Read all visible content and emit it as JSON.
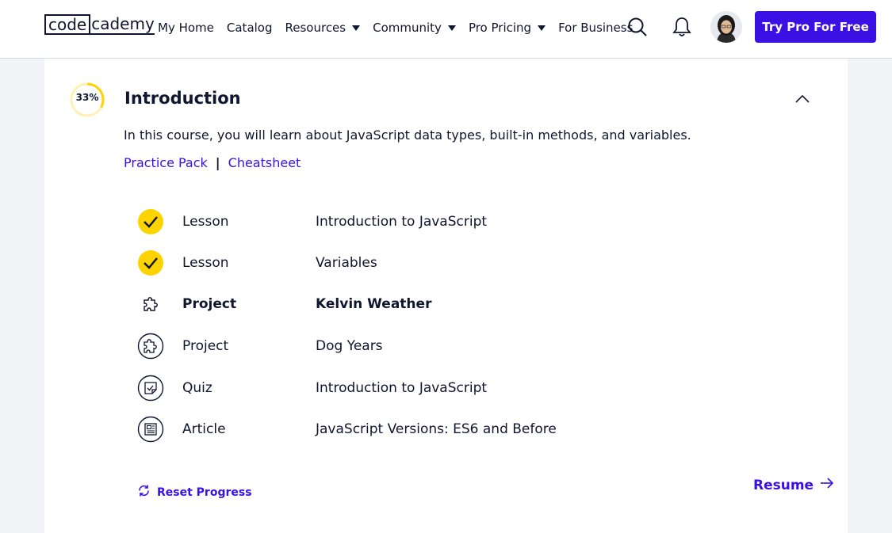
{
  "nav": {
    "logo_box": "code",
    "logo_rest": "cademy",
    "links": [
      {
        "label": "My Home",
        "has_caret": false
      },
      {
        "label": "Catalog",
        "has_caret": false
      },
      {
        "label": "Resources",
        "has_caret": true
      },
      {
        "label": "Community",
        "has_caret": true
      },
      {
        "label": "Pro Pricing",
        "has_caret": true
      },
      {
        "label": "For Business",
        "has_caret": false
      }
    ],
    "cta_label": "Try Pro For Free"
  },
  "module": {
    "progress_label": "33%",
    "progress_fraction": 0.33,
    "title": "Introduction",
    "description": "In this course, you will learn about JavaScript data types, built-in methods, and variables.",
    "practice_link": "Practice Pack",
    "separator": "|",
    "cheatsheet_link": "Cheatsheet",
    "items": [
      {
        "type": "Lesson",
        "title": "Introduction to JavaScript",
        "icon": "check-icon",
        "status": "completed",
        "current": false
      },
      {
        "type": "Lesson",
        "title": "Variables",
        "icon": "check-icon",
        "status": "completed",
        "current": false
      },
      {
        "type": "Project",
        "title": "Kelvin Weather",
        "icon": "puzzle-icon",
        "status": "current",
        "current": true
      },
      {
        "type": "Project",
        "title": "Dog Years",
        "icon": "puzzle-icon",
        "status": "not-started",
        "current": false
      },
      {
        "type": "Quiz",
        "title": "Introduction to JavaScript",
        "icon": "quiz-icon",
        "status": "not-started",
        "current": false
      },
      {
        "type": "Article",
        "title": "JavaScript Versions: ES6 and Before",
        "icon": "article-icon",
        "status": "not-started",
        "current": false
      }
    ],
    "reset_label": "Reset Progress",
    "resume_label": "Resume"
  },
  "colors": {
    "accent": "#3a10e5",
    "complete": "#ffd300",
    "text": "#10162f",
    "background": "#f2f3f7"
  }
}
